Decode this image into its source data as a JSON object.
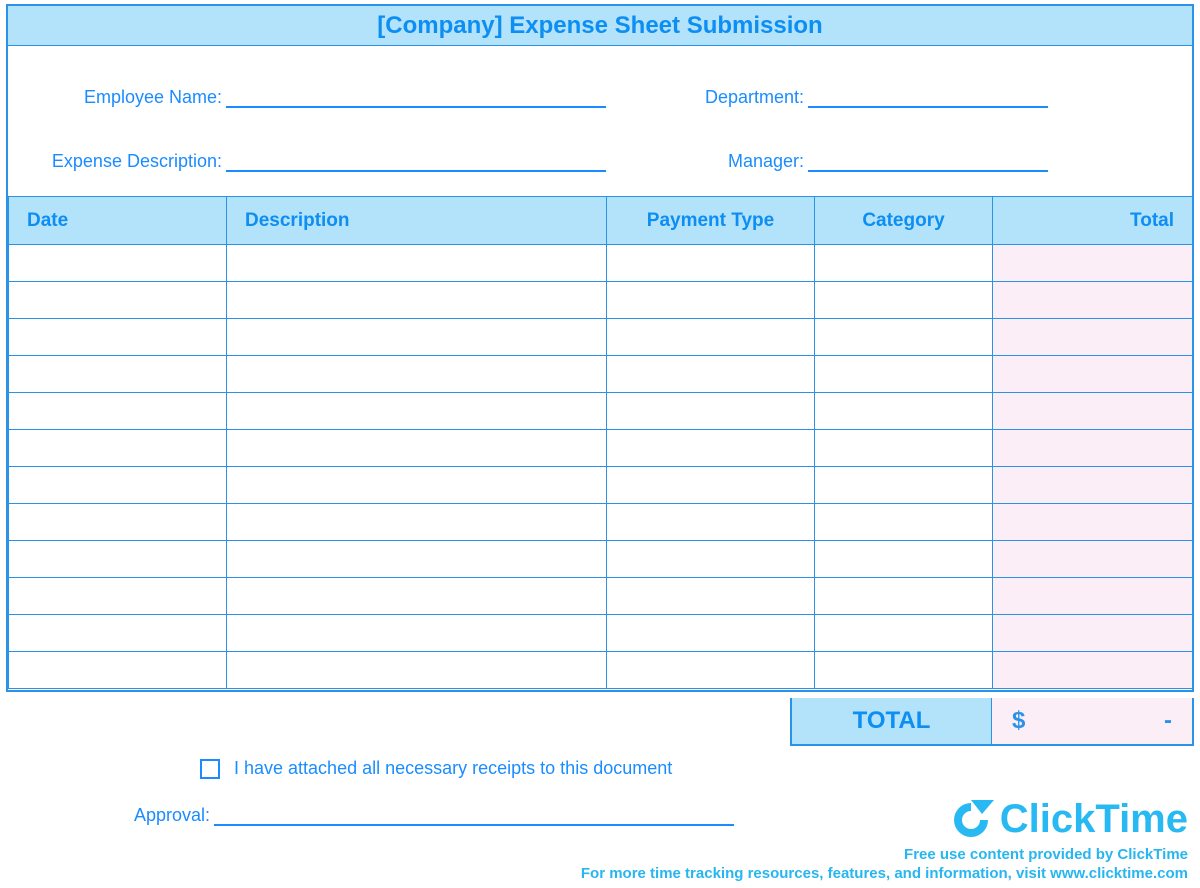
{
  "title": "[Company] Expense Sheet Submission",
  "fields": {
    "employee_name_label": "Employee Name:",
    "department_label": "Department:",
    "expense_description_label": "Expense Description:",
    "manager_label": "Manager:",
    "employee_name_value": "",
    "department_value": "",
    "expense_description_value": "",
    "manager_value": ""
  },
  "columns": {
    "date": "Date",
    "description": "Description",
    "payment_type": "Payment Type",
    "category": "Category",
    "total": "Total"
  },
  "grand_total": {
    "label": "TOTAL",
    "currency": "$",
    "value": "-"
  },
  "confirmation": {
    "checked": false,
    "text": "I have attached all necessary receipts to this document"
  },
  "approval": {
    "label": "Approval:",
    "value": ""
  },
  "branding": {
    "logo_text": "ClickTime",
    "line1": "Free use content provided by ClickTime",
    "line2": "For more time tracking resources, features, and information, visit www.clicktime.com"
  }
}
